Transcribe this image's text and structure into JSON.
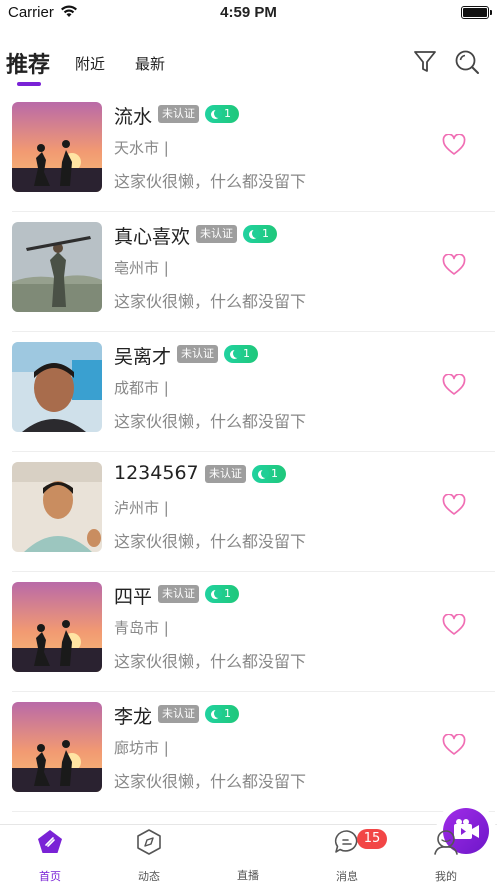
{
  "status_bar": {
    "carrier": "Carrier",
    "time": "4:59 PM"
  },
  "top_tabs": {
    "recommended": "推荐",
    "nearby": "附近",
    "latest": "最新"
  },
  "users": [
    {
      "name": "流水",
      "verify": "未认证",
      "level": "1",
      "city": "天水市 |",
      "bio": "这家伙很懒，什么都没留下",
      "avatar": "sunset-couple"
    },
    {
      "name": "真心喜欢",
      "verify": "未认证",
      "level": "1",
      "city": "亳州市 |",
      "bio": "这家伙很懒，什么都没留下",
      "avatar": "game-soldier"
    },
    {
      "name": "吴离才",
      "verify": "未认证",
      "level": "1",
      "city": "成都市 |",
      "bio": "这家伙很懒，什么都没留下",
      "avatar": "man-photo"
    },
    {
      "name": "1234567",
      "verify": "未认证",
      "level": "1",
      "city": "泸州市 |",
      "bio": "这家伙很懒，什么都没留下",
      "avatar": "boy-photo"
    },
    {
      "name": "四平",
      "verify": "未认证",
      "level": "1",
      "city": "青岛市 |",
      "bio": "这家伙很懒，什么都没留下",
      "avatar": "sunset-couple"
    },
    {
      "name": "李龙",
      "verify": "未认证",
      "level": "1",
      "city": "廊坊市 |",
      "bio": "这家伙很懒，什么都没留下",
      "avatar": "sunset-couple"
    }
  ],
  "tab_bar": {
    "home": "首页",
    "feed": "动态",
    "live": "直播",
    "messages": "消息",
    "messages_badge": "15",
    "mine": "我的"
  },
  "colors": {
    "accent": "#7a22d6",
    "like": "#f06eb4",
    "level": "#20d2a0",
    "badge": "#f24646"
  }
}
